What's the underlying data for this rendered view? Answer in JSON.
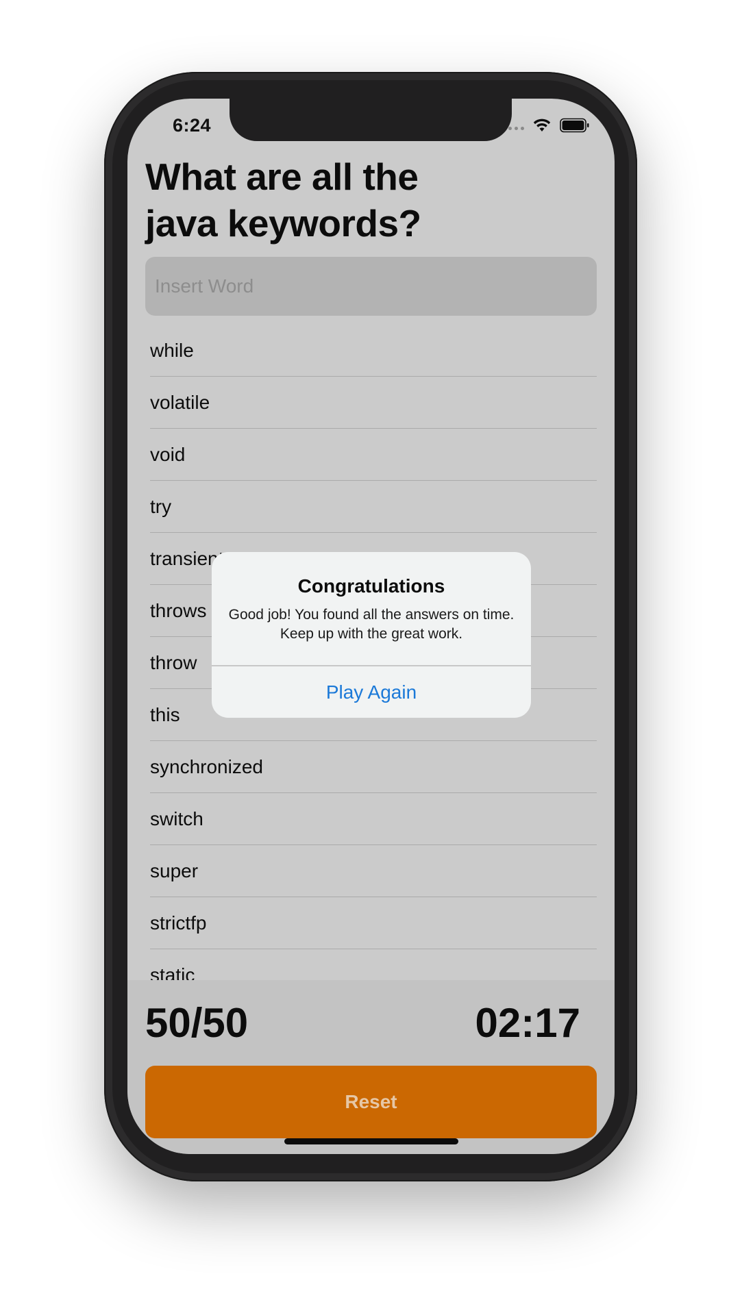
{
  "status_bar": {
    "time": "6:24",
    "icons": [
      "signal-dots-icon",
      "wifi-icon",
      "battery-icon"
    ]
  },
  "question": {
    "title_line1": "What are all the",
    "title_line2": "java keywords?"
  },
  "input": {
    "value": "",
    "placeholder": "Insert Word"
  },
  "answers": [
    "while",
    "volatile",
    "void",
    "try",
    "transient",
    "throws",
    "throw",
    "this",
    "synchronized",
    "switch",
    "super",
    "strictfp",
    "static"
  ],
  "footer": {
    "score": "50/50",
    "timer": "02:17",
    "reset_label": "Reset"
  },
  "alert": {
    "title": "Congratulations",
    "message": "Good job! You found all the answers on time. Keep up with the great work.",
    "button_label": "Play Again"
  },
  "colors": {
    "accent_orange": "#cb6802",
    "alert_button_blue": "#1b79d8",
    "screen_background": "#cbcbcb"
  }
}
